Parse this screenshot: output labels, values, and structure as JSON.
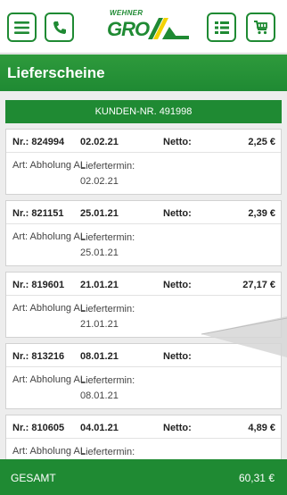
{
  "topbar": {
    "logo_top": "WEHNER",
    "logo_main": "GRO",
    "icons": [
      "menu-icon",
      "phone-icon",
      "list-icon",
      "cart-icon"
    ]
  },
  "header": {
    "title": "Lieferscheine"
  },
  "customer": {
    "label": "KUNDEN-NR. 491998"
  },
  "labels": {
    "netto": "Netto:",
    "lieftermin": "Liefertermin:"
  },
  "deliveries": [
    {
      "nr": "Nr.: 824994",
      "date": "02.02.21",
      "amount": "2,25 €",
      "art": "Art: Abholung AL",
      "termin": "02.02.21"
    },
    {
      "nr": "Nr.: 821151",
      "date": "25.01.21",
      "amount": "2,39 €",
      "art": "Art: Abholung AL",
      "termin": "25.01.21"
    },
    {
      "nr": "Nr.: 819601",
      "date": "21.01.21",
      "amount": "27,17 €",
      "art": "Art: Abholung AL",
      "termin": "21.01.21"
    },
    {
      "nr": "Nr.: 813216",
      "date": "08.01.21",
      "amount": "",
      "art": "Art: Abholung AL",
      "termin": "08.01.21"
    },
    {
      "nr": "Nr.: 810605",
      "date": "04.01.21",
      "amount": "4,89 €",
      "art": "Art: Abholung AL",
      "termin": ""
    }
  ],
  "footer": {
    "label": "GESAMT",
    "total": "60,31 €"
  },
  "colors": {
    "brand_green": "#1f8a33",
    "background": "#ededed"
  }
}
